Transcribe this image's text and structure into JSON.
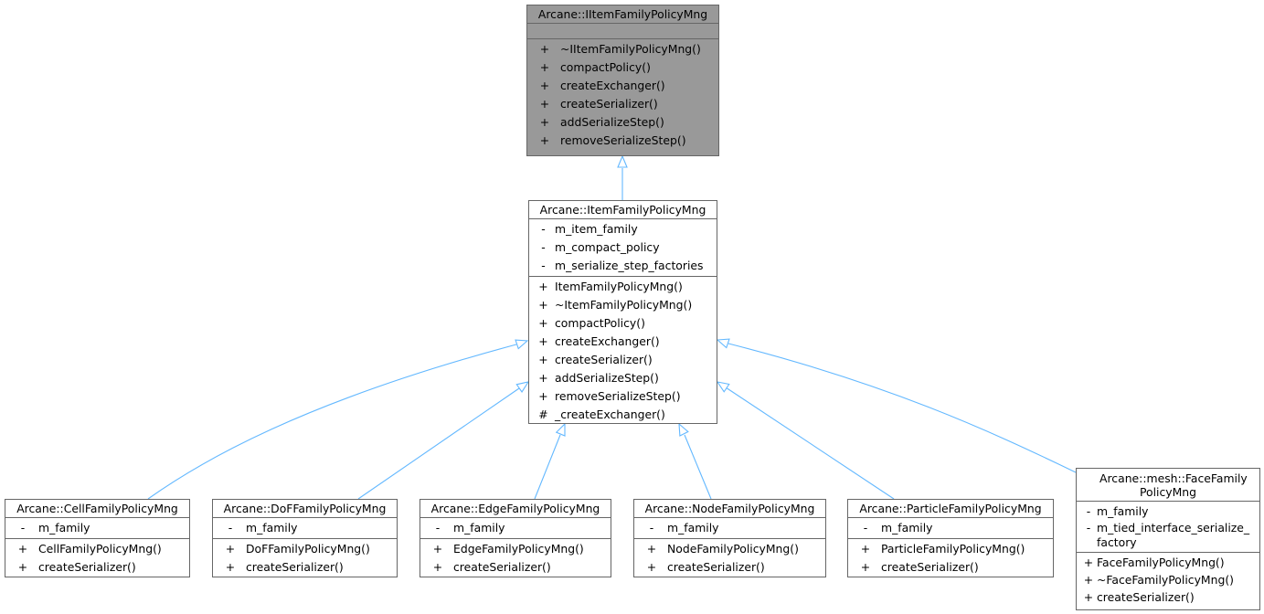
{
  "diagram": {
    "colors": {
      "edge": "#63b8ff",
      "base_fill": "#999999",
      "border": "#666666"
    },
    "classes": {
      "iitem": {
        "name": "Arcane::IItemFamilyPolicyMng",
        "attributes": [],
        "methods": [
          {
            "vis": "+",
            "name": "~IItemFamilyPolicyMng()"
          },
          {
            "vis": "+",
            "name": "compactPolicy()"
          },
          {
            "vis": "+",
            "name": "createExchanger()"
          },
          {
            "vis": "+",
            "name": "createSerializer()"
          },
          {
            "vis": "+",
            "name": "addSerializeStep()"
          },
          {
            "vis": "+",
            "name": "removeSerializeStep()"
          }
        ]
      },
      "item": {
        "name": "Arcane::ItemFamilyPolicyMng",
        "attributes": [
          {
            "vis": "-",
            "name": "m_item_family"
          },
          {
            "vis": "-",
            "name": "m_compact_policy"
          },
          {
            "vis": "-",
            "name": "m_serialize_step_factories"
          }
        ],
        "methods": [
          {
            "vis": "+",
            "name": "ItemFamilyPolicyMng()"
          },
          {
            "vis": "+",
            "name": "~ItemFamilyPolicyMng()"
          },
          {
            "vis": "+",
            "name": "compactPolicy()"
          },
          {
            "vis": "+",
            "name": "createExchanger()"
          },
          {
            "vis": "+",
            "name": "createSerializer()"
          },
          {
            "vis": "+",
            "name": "addSerializeStep()"
          },
          {
            "vis": "+",
            "name": "removeSerializeStep()"
          },
          {
            "vis": "#",
            "name": "_createExchanger()"
          }
        ]
      },
      "cell": {
        "name": "Arcane::CellFamilyPolicyMng",
        "attributes": [
          {
            "vis": "-",
            "name": "m_family"
          }
        ],
        "methods": [
          {
            "vis": "+",
            "name": "CellFamilyPolicyMng()"
          },
          {
            "vis": "+",
            "name": "createSerializer()"
          }
        ]
      },
      "dof": {
        "name": "Arcane::DoFFamilyPolicyMng",
        "attributes": [
          {
            "vis": "-",
            "name": "m_family"
          }
        ],
        "methods": [
          {
            "vis": "+",
            "name": "DoFFamilyPolicyMng()"
          },
          {
            "vis": "+",
            "name": "createSerializer()"
          }
        ]
      },
      "edge": {
        "name": "Arcane::EdgeFamilyPolicyMng",
        "attributes": [
          {
            "vis": "-",
            "name": "m_family"
          }
        ],
        "methods": [
          {
            "vis": "+",
            "name": "EdgeFamilyPolicyMng()"
          },
          {
            "vis": "+",
            "name": "createSerializer()"
          }
        ]
      },
      "node": {
        "name": "Arcane::NodeFamilyPolicyMng",
        "attributes": [
          {
            "vis": "-",
            "name": "m_family"
          }
        ],
        "methods": [
          {
            "vis": "+",
            "name": "NodeFamilyPolicyMng()"
          },
          {
            "vis": "+",
            "name": "createSerializer()"
          }
        ]
      },
      "particle": {
        "name": "Arcane::ParticleFamilyPolicyMng",
        "attributes": [
          {
            "vis": "-",
            "name": "m_family"
          }
        ],
        "methods": [
          {
            "vis": "+",
            "name": "ParticleFamilyPolicyMng()"
          },
          {
            "vis": "+",
            "name": "createSerializer()"
          }
        ]
      },
      "face": {
        "name": "Arcane::mesh::FaceFamily PolicyMng",
        "attributes": [
          {
            "vis": "-",
            "name": "m_family"
          },
          {
            "vis": "-",
            "name": "m_tied_interface_serialize_factory"
          }
        ],
        "methods": [
          {
            "vis": "+",
            "name": "FaceFamilyPolicyMng()"
          },
          {
            "vis": "+",
            "name": "~FaceFamilyPolicyMng()"
          },
          {
            "vis": "+",
            "name": "createSerializer()"
          }
        ]
      }
    },
    "inheritance": [
      {
        "child": "item",
        "parent": "iitem"
      },
      {
        "child": "cell",
        "parent": "item"
      },
      {
        "child": "dof",
        "parent": "item"
      },
      {
        "child": "edge",
        "parent": "item"
      },
      {
        "child": "node",
        "parent": "item"
      },
      {
        "child": "particle",
        "parent": "item"
      },
      {
        "child": "face",
        "parent": "item"
      }
    ]
  }
}
